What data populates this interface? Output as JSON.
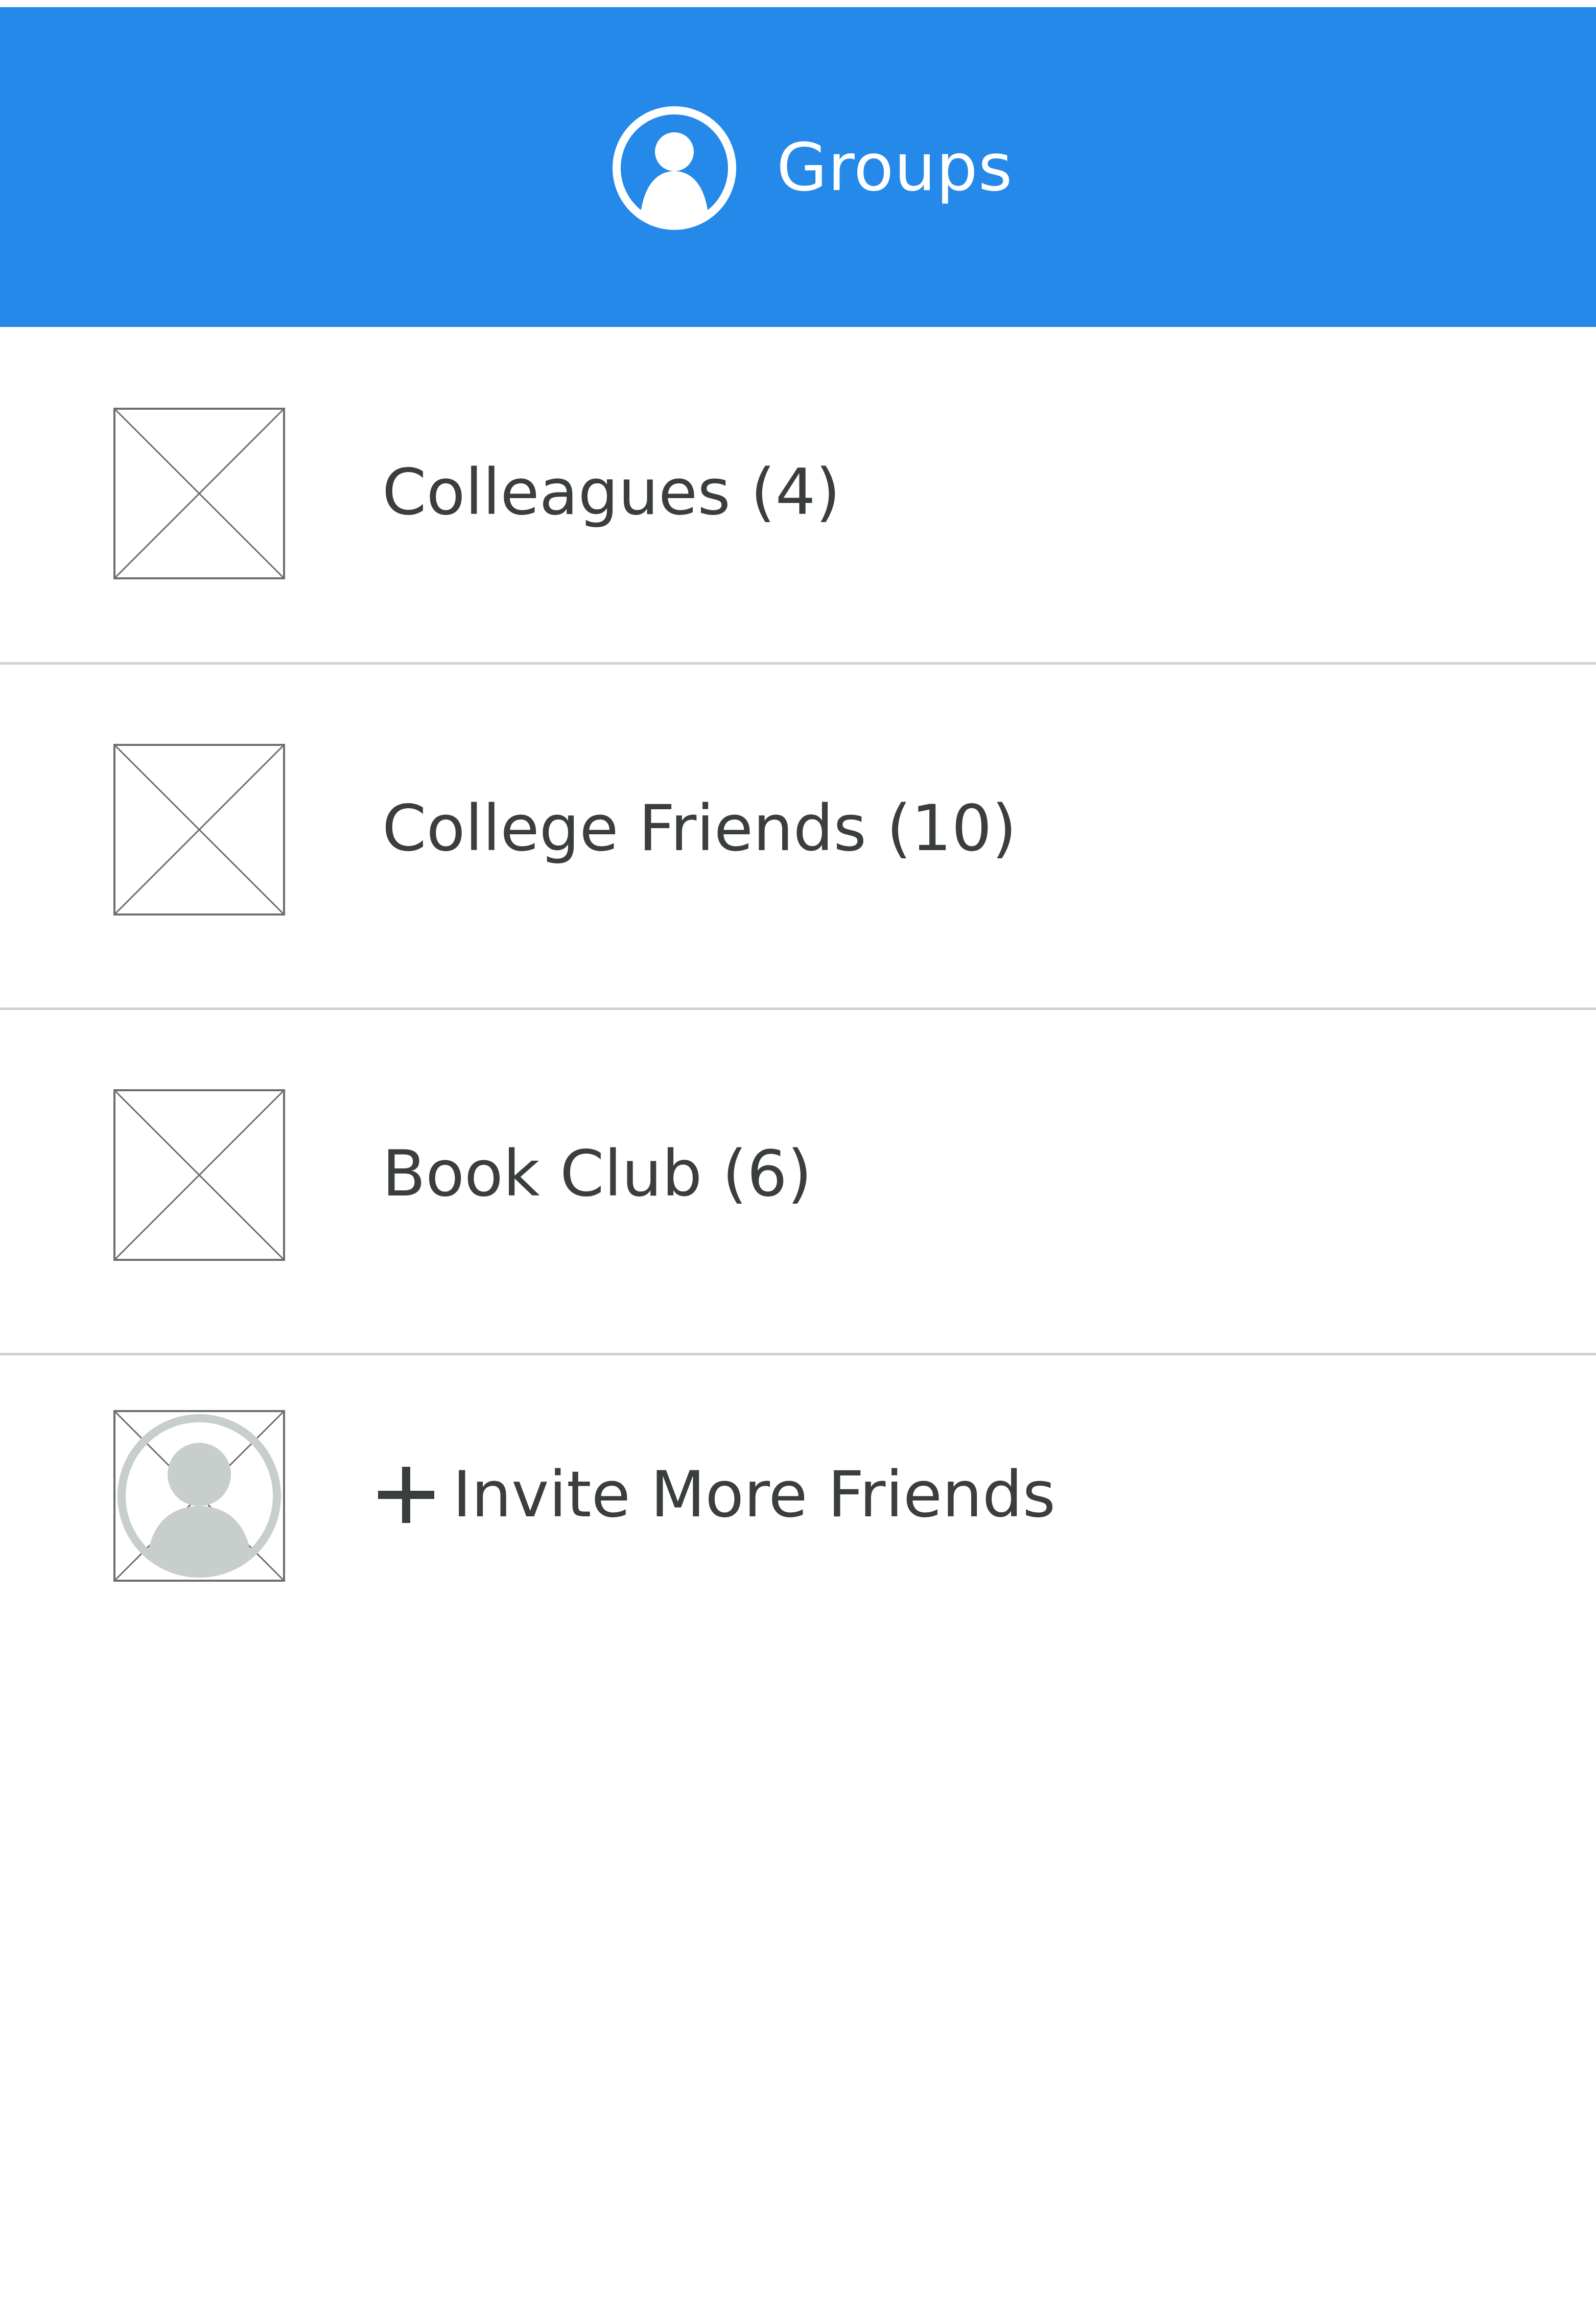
{
  "header": {
    "title": "Groups",
    "icon": "user-circle-icon",
    "background_color": "#2489e8"
  },
  "groups": [
    {
      "label": "Colleagues (4)",
      "thumbnail": "image-placeholder-icon"
    },
    {
      "label": "College Friends (10)",
      "thumbnail": "image-placeholder-icon"
    },
    {
      "label": "Book Club (6)",
      "thumbnail": "image-placeholder-icon"
    }
  ],
  "invite": {
    "label": "Invite More Friends",
    "icon": "plus-icon",
    "avatar": "avatar-placeholder-icon"
  },
  "colors": {
    "accent": "#2489e8",
    "text": "#3a3e3c",
    "divider": "#d0d2d1",
    "placeholder_stroke": "#6e6e6e",
    "avatar_fill": "#c8cecb"
  }
}
